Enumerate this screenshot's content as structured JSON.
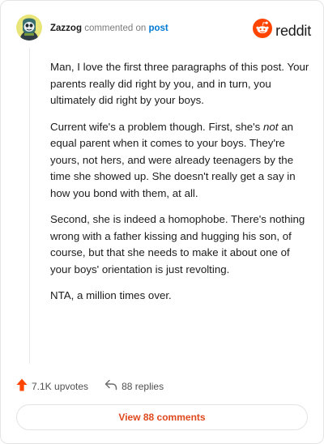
{
  "comment": {
    "author": "Zazzog",
    "action_text": "commented on",
    "target_link": "post",
    "paragraphs": [
      [
        "Man, I love the first three paragraphs of this post. Your parents really did right by you, and in turn, you ultimately did right by your boys."
      ],
      [
        "Current wife's a problem though. First, she's ",
        "not",
        " an equal parent when it comes to your boys. They're yours, not hers, and were already teenagers by the time she showed up. She doesn't really get a say in how you bond with them, at all."
      ],
      [
        "Second, she is indeed a homophobe. There's nothing wrong with a father kissing and hugging his son, of course, but that she needs to make it about one of your boys' orientation is just revolting."
      ],
      [
        "NTA, a million times over."
      ]
    ]
  },
  "brand": {
    "name": "reddit",
    "icon": "reddit-snoo-icon",
    "color": "#ff4500"
  },
  "avatar": {
    "icon": "alien-face-icon"
  },
  "footer": {
    "upvotes": "7.1K upvotes",
    "upvote_icon": "upvote-arrow-icon",
    "upvote_color": "#ff4500",
    "replies": "88 replies",
    "reply_icon": "reply-arrow-icon",
    "view_button": "View 88 comments",
    "view_button_color": "#e0481d"
  }
}
